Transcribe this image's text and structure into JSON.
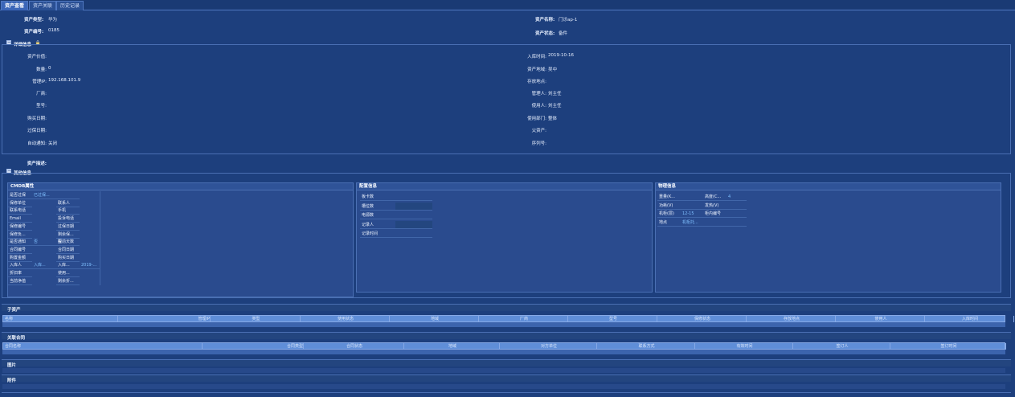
{
  "tabs": [
    {
      "label": "资产查看"
    },
    {
      "label": "资产关联"
    },
    {
      "label": "历史记录"
    }
  ],
  "summary": {
    "asset_type_label": "资产类型:",
    "asset_type_value": "华为",
    "asset_name_label": "资产名称:",
    "asset_name_value": "门诊ap-1",
    "asset_no_label": "资产编号:",
    "asset_no_value": "0185",
    "asset_status_label": "资产状态:",
    "asset_status_value": "备件"
  },
  "detail": {
    "title": "详细信息",
    "left": [
      {
        "label": "资产价值:",
        "value": ""
      },
      {
        "label": "数量:",
        "value": "0"
      },
      {
        "label": "管理IP:",
        "value": "192.168.101.9"
      },
      {
        "label": "厂商:",
        "value": ""
      },
      {
        "label": "型号:",
        "value": ""
      },
      {
        "label": "购买日期:",
        "value": ""
      },
      {
        "label": "过保日期:",
        "value": ""
      },
      {
        "label": "自动通知:",
        "value": "关闭"
      }
    ],
    "right": [
      {
        "label": "入库时间:",
        "value": "2019-10-16"
      },
      {
        "label": "资产地域:",
        "value": "吴中"
      },
      {
        "label": "存放地点:",
        "value": ""
      },
      {
        "label": "管理人:",
        "value": "刘主任"
      },
      {
        "label": "使用人:",
        "value": "刘主任"
      },
      {
        "label": "使用部门:",
        "value": "整体"
      },
      {
        "label": "父资产:",
        "value": ""
      },
      {
        "label": "序列号:",
        "value": ""
      }
    ],
    "desc_label": "资产描述:"
  },
  "other": {
    "title": "其他信息",
    "cmdb": {
      "title": "CMDB属性",
      "rows": [
        [
          "是否过保",
          "已过保..."
        ],
        [
          "保修单位",
          "联系人"
        ],
        [
          "联系电话",
          "手机"
        ],
        [
          "Email",
          "投诉电话"
        ],
        [
          "保修编号",
          "过保日期"
        ],
        [
          "保修负...",
          "剩余保..."
        ],
        [
          "是否通知",
          "否",
          "提前天数"
        ],
        [
          "合同编号",
          "合同日期"
        ],
        [
          "购置金额",
          "购买日期"
        ],
        [
          "入库人",
          "入库...",
          "2019-..."
        ],
        [
          "折旧率",
          "使用..."
        ],
        [
          "当前净值",
          "剩余折..."
        ]
      ]
    },
    "config": {
      "title": "配置信息",
      "rows": [
        "板卡数",
        "槽位数",
        "电源数",
        "记录人",
        "记录时间"
      ]
    },
    "physical": {
      "title": "物理信息",
      "rows": [
        [
          "重量(K...",
          "",
          "高度(C...",
          "4"
        ],
        [
          "功耗(V)",
          "",
          "发热(V)",
          ""
        ],
        [
          "机柜(层)",
          "12-15",
          "柜内编号",
          ""
        ],
        [
          "地点",
          "机柜托...",
          "",
          ""
        ]
      ]
    }
  },
  "sub_assets": {
    "title": "子资产",
    "columns": [
      "名称",
      "管理IP",
      "类型",
      "使用状态",
      "地域",
      "厂商",
      "型号",
      "保修状态",
      "存放地点",
      "使用人",
      "入库时间"
    ]
  },
  "contracts": {
    "title": "关联合同",
    "columns": [
      "合同名称",
      "合同类型",
      "合同状态",
      "地域",
      "对方单位",
      "联系方式",
      "有效时间",
      "签订人",
      "签订时间"
    ]
  },
  "pictures": {
    "title": "图片"
  },
  "attachments": {
    "title": "附件"
  },
  "colors": {
    "background": "#1d3f7d",
    "header_row": "#5f8ed8",
    "link": "#7fc0ff"
  }
}
